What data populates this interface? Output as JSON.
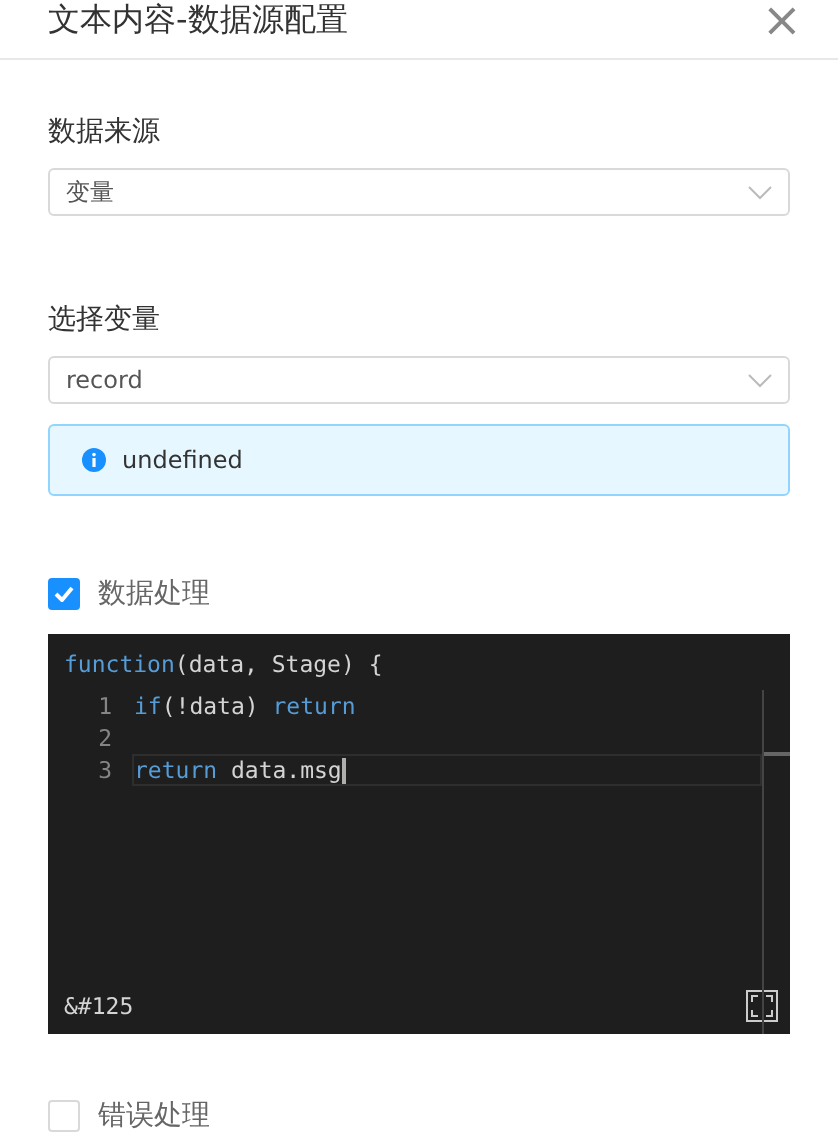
{
  "dialog": {
    "title": "文本内容-数据源配置",
    "close": "×"
  },
  "fields": [
    {
      "label": "数据来源",
      "value": "变量"
    },
    {
      "label": "选择变量",
      "value": "record"
    }
  ],
  "alert": {
    "text": "undefined"
  },
  "data_processing": {
    "label": "数据处理",
    "checked": true
  },
  "editor": {
    "header": [
      {
        "text": "function",
        "kind": "keyword"
      },
      {
        "text": "(data, Stage) {",
        "kind": "plain"
      }
    ],
    "lines": [
      {
        "number": "1",
        "current": false,
        "tokens": [
          {
            "text": "if",
            "kind": "keyword"
          },
          {
            "text": "(!data) ",
            "kind": "plain"
          },
          {
            "text": "return",
            "kind": "keyword"
          }
        ]
      },
      {
        "number": "2",
        "current": false
      },
      {
        "number": "3",
        "current": true,
        "tokens": [
          {
            "text": "return",
            "kind": "keyword"
          },
          {
            "text": " data.msg",
            "kind": "plain"
          }
        ]
      }
    ],
    "footer": "&#125"
  },
  "error_handling": {
    "label": "错误处理",
    "checked": false
  }
}
